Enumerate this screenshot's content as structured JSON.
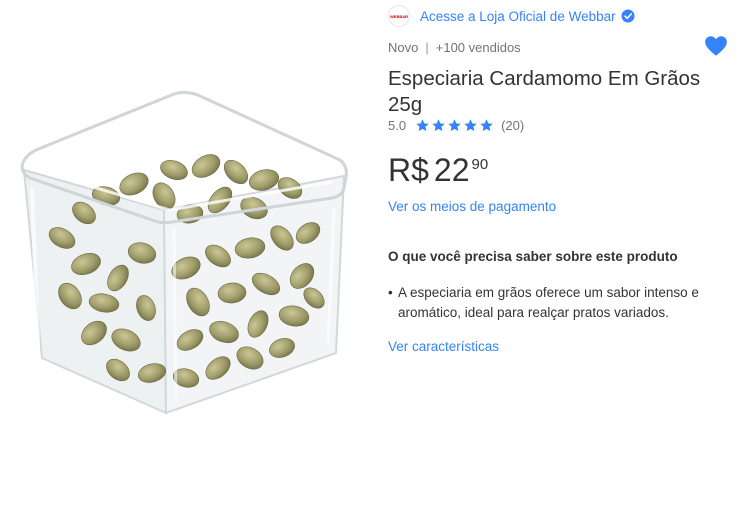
{
  "store": {
    "logo_text": "WEBBAR",
    "link_label": "Acesse a Loja Oficial de Webbar",
    "verified_icon": "verified-check-icon"
  },
  "product": {
    "condition": "Novo",
    "separator": "|",
    "sold": "+100 vendidos",
    "title": "Especiaria Cardamomo Em Grãos 25g",
    "image_alt": "Cardamomo em grãos em pote plástico quadrado",
    "favorite_icon": "heart-icon",
    "favorite_active": true
  },
  "rating": {
    "score": "5.0",
    "stars_filled": 5,
    "stars_total": 5,
    "review_count": "(20)"
  },
  "price": {
    "currency": "R$",
    "integer": "22",
    "cents": "90"
  },
  "payment_link": "Ver os meios de pagamento",
  "features_section": {
    "heading": "O que você precisa saber sobre este produto",
    "items": [
      "A especiaria em grãos oferece um sabor intenso e aromático, ideal para realçar pratos variados."
    ],
    "more_link": "Ver características"
  },
  "colors": {
    "accent": "#3483fa",
    "text": "#333333",
    "muted": "#737373"
  }
}
